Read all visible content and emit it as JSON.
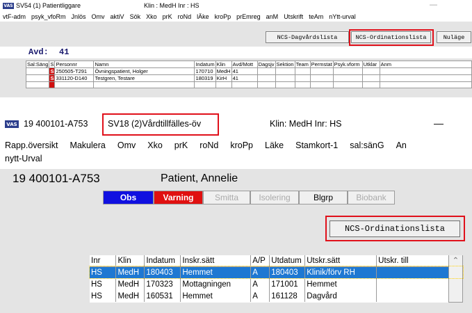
{
  "w1": {
    "icon": "VAS",
    "title_left": "SV54 (1) Patientliggare",
    "title_mid": "Klin : MedH  Inr : HS",
    "minimize_glyph": "—",
    "menu": [
      "vtF-adm",
      "psyk_vfoRm",
      "Jnlös",
      "Omv",
      "aktiV",
      "Sök",
      "Xko",
      "prK",
      "roNd",
      "lÄke",
      "kroPp",
      "prEmreg",
      "anM",
      "Utskrift",
      "teAm",
      "nYtt-urval"
    ],
    "buttons": [
      "NCS-Dagvårdslista",
      "NCS-Ordinationslista",
      "Nuläge"
    ],
    "avd_label": "Avd:",
    "avd_value": "41",
    "grid_headers": [
      "Sal:Säng",
      "S",
      "Personnr",
      "Namn",
      "Indatum",
      "Klin",
      "Avd/Mott",
      "Dagsjv",
      "Sektion",
      "Team",
      "Permstat",
      "Psyk.vform",
      "Utklar",
      "Anm"
    ],
    "grid_rows": [
      {
        "s": "S",
        "personnr": "250505-T291",
        "namn": "Övningspatient, Holger",
        "indatum": "170710",
        "klin": "MedH",
        "avd": "41"
      },
      {
        "s": "S",
        "personnr": "331120-D140",
        "namn": "Testgren, Testare",
        "indatum": "180319",
        "klin": "KirH",
        "avd": "41"
      }
    ]
  },
  "w2": {
    "icon": "VAS",
    "title_left": "19 400101-A753",
    "title_mid": "SV18 (2)Vårdtillfälles-öv",
    "title_right": "Klin: MedH  Inr: HS",
    "minimize_glyph": "—",
    "menu": [
      "Rapp.översikt",
      "Makulera",
      "Omv",
      "Xko",
      "prK",
      "roNd",
      "kroPp",
      "Läke",
      "Stamkort-1",
      "sal:sänG",
      "An"
    ],
    "menu2": "nytt-Urval",
    "patient_id": "19 400101-A753",
    "patient_name": "Patient, Annelie",
    "flags": [
      "Obs",
      "Varning",
      "Smitta",
      "Isolering",
      "Blgrp",
      "Biobank"
    ],
    "ncs_button": "NCS-Ordinationslista",
    "grid_headers": [
      "Inr",
      "Klin",
      "Indatum",
      "Inskr.sätt",
      "A/P",
      "Utdatum",
      "Utskr.sätt",
      "Utskr. till"
    ],
    "grid_rows": [
      {
        "inr": "HS",
        "klin": "MedH",
        "indatum": "180403",
        "inskr": "Hemmet",
        "ap": "A",
        "utdatum": "180403",
        "utskr": "Klinik/förv RH",
        "till": ""
      },
      {
        "inr": "HS",
        "klin": "MedH",
        "indatum": "170323",
        "inskr": "Mottagningen",
        "ap": "A",
        "utdatum": "171001",
        "utskr": "Hemmet",
        "till": ""
      },
      {
        "inr": "HS",
        "klin": "MedH",
        "indatum": "160531",
        "inskr": "Hemmet",
        "ap": "A",
        "utdatum": "161128",
        "utskr": "Dagvård",
        "till": ""
      }
    ],
    "scroll_up_glyph": "⌃"
  },
  "colors": {
    "highlight_box": "#e0101a",
    "obs_bg": "#1010e0",
    "varning_bg": "#e01010",
    "selected_row": "#1e78d2"
  }
}
